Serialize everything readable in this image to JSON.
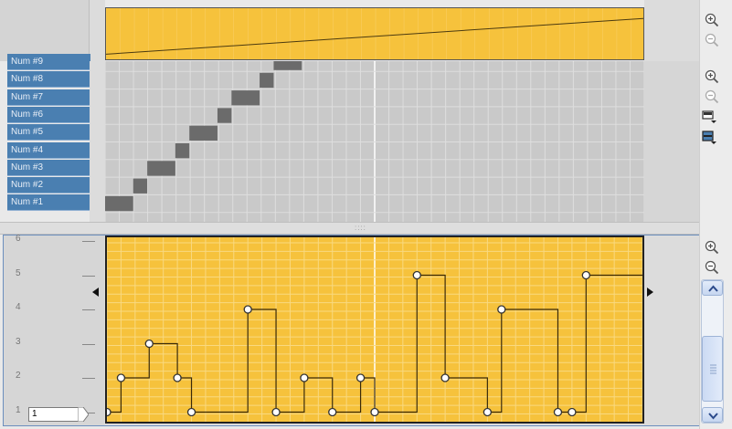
{
  "rows": [
    "Num #9",
    "Num #8",
    "Num #7",
    "Num #6",
    "Num #5",
    "Num #4",
    "Num #3",
    "Num #2",
    "Num #1"
  ],
  "value_axis": {
    "ticks": [
      1,
      2,
      3,
      4,
      5,
      6
    ]
  },
  "value_input": {
    "value": "1"
  },
  "notes": [
    {
      "row": 1,
      "start": 0,
      "len": 2
    },
    {
      "row": 2,
      "start": 2,
      "len": 1
    },
    {
      "row": 3,
      "start": 3,
      "len": 2
    },
    {
      "row": 4,
      "start": 5,
      "len": 1
    },
    {
      "row": 5,
      "start": 6,
      "len": 2
    },
    {
      "row": 6,
      "start": 8,
      "len": 1
    },
    {
      "row": 7,
      "start": 9,
      "len": 2
    },
    {
      "row": 8,
      "start": 11,
      "len": 1
    },
    {
      "row": 9,
      "start": 12,
      "len": 2
    }
  ],
  "automation_points": [
    {
      "step": 0,
      "value": 1
    },
    {
      "step": 1,
      "value": 2
    },
    {
      "step": 3,
      "value": 3
    },
    {
      "step": 5,
      "value": 2
    },
    {
      "step": 6,
      "value": 1
    },
    {
      "step": 10,
      "value": 4
    },
    {
      "step": 12,
      "value": 1
    },
    {
      "step": 14,
      "value": 2
    },
    {
      "step": 16,
      "value": 1
    },
    {
      "step": 18,
      "value": 2
    },
    {
      "step": 19,
      "value": 1
    },
    {
      "step": 22,
      "value": 5
    },
    {
      "step": 24,
      "value": 2
    },
    {
      "step": 27,
      "value": 1
    },
    {
      "step": 28,
      "value": 4
    },
    {
      "step": 32,
      "value": 1
    },
    {
      "step": 33,
      "value": 1
    },
    {
      "step": 34,
      "value": 5
    }
  ],
  "tempo_ramp": {
    "start": 0.1,
    "end": 0.8
  },
  "colors": {
    "lane": "#f6c23c",
    "row_label": "#4a7fb1",
    "note": "#6b6b6b",
    "grid_light": "#ffffff"
  },
  "icons": {
    "zoom_in": "zoom-in-icon",
    "zoom_out": "zoom-out-icon",
    "lane_view_a": "lane-view-icon",
    "lane_view_b": "lane-color-icon"
  }
}
